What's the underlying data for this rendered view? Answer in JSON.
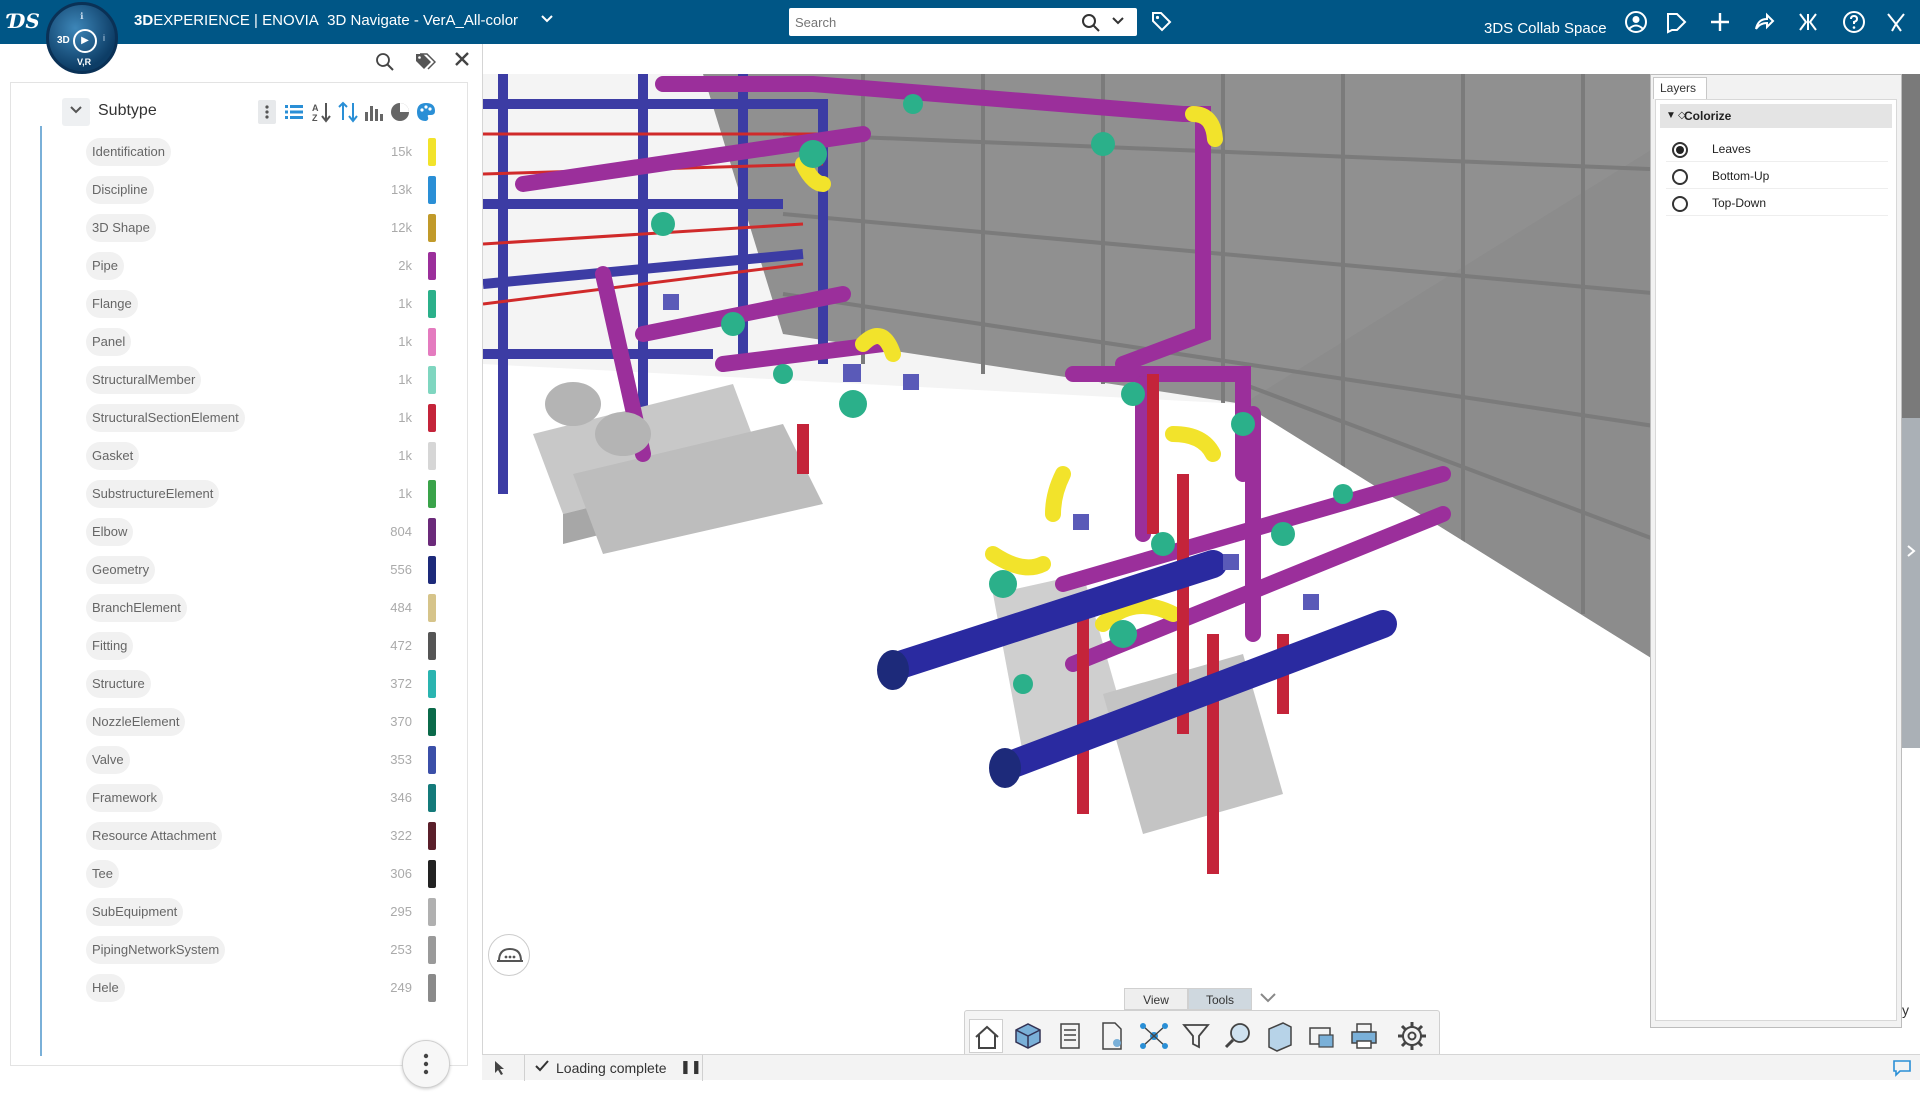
{
  "header": {
    "brand_bold": "3D",
    "brand_rest": "EXPERIENCE | ENOVIA",
    "app_name": "3D Navigate - VerA_All-color",
    "search_placeholder": "Search",
    "collab_space": "3DS Collab Space",
    "compass": {
      "label_3d": "3D",
      "label_vr": "V,R",
      "label_top": "ℹ",
      "label_right": "i"
    }
  },
  "facets": {
    "title": "Subtype",
    "items": [
      {
        "label": "Identification",
        "count": "15k",
        "color": "#f2e32b"
      },
      {
        "label": "Discipline",
        "count": "13k",
        "color": "#2a8fd6"
      },
      {
        "label": "3D Shape",
        "count": "12k",
        "color": "#c19a2a"
      },
      {
        "label": "Pipe",
        "count": "2k",
        "color": "#9b2f9b"
      },
      {
        "label": "Flange",
        "count": "1k",
        "color": "#2bb08a"
      },
      {
        "label": "Panel",
        "count": "1k",
        "color": "#e47bbf"
      },
      {
        "label": "StructuralMember",
        "count": "1k",
        "color": "#7fd6c0"
      },
      {
        "label": "StructuralSectionElement",
        "count": "1k",
        "color": "#c4243a"
      },
      {
        "label": "Gasket",
        "count": "1k",
        "color": "#d6d6d6"
      },
      {
        "label": "SubstructureElement",
        "count": "1k",
        "color": "#3aa34a"
      },
      {
        "label": "Elbow",
        "count": "804",
        "color": "#6b2a7a"
      },
      {
        "label": "Geometry",
        "count": "556",
        "color": "#1d2a7a"
      },
      {
        "label": "BranchElement",
        "count": "484",
        "color": "#d6c48a"
      },
      {
        "label": "Fitting",
        "count": "472",
        "color": "#555555"
      },
      {
        "label": "Structure",
        "count": "372",
        "color": "#2ab4b0"
      },
      {
        "label": "NozzleElement",
        "count": "370",
        "color": "#0b6a4a"
      },
      {
        "label": "Valve",
        "count": "353",
        "color": "#3b4fa8"
      },
      {
        "label": "Framework",
        "count": "346",
        "color": "#147a7a"
      },
      {
        "label": "Resource Attachment",
        "count": "322",
        "color": "#5a1f2a"
      },
      {
        "label": "Tee",
        "count": "306",
        "color": "#222222"
      },
      {
        "label": "SubEquipment",
        "count": "295",
        "color": "#b0b0b0"
      },
      {
        "label": "PipingNetworkSystem",
        "count": "253",
        "color": "#9a9a9a"
      },
      {
        "label": "Hele",
        "count": "249",
        "color": "#8a8a8a"
      }
    ]
  },
  "layers": {
    "tab": "Layers",
    "group": "Colorize",
    "options": [
      {
        "label": "Leaves",
        "selected": true
      },
      {
        "label": "Bottom-Up",
        "selected": false
      },
      {
        "label": "Top-Down",
        "selected": false
      }
    ]
  },
  "actionbar": {
    "tabs": [
      "View",
      "Tools"
    ],
    "active_tab": "Tools",
    "buttons": [
      "home-icon",
      "3d-box-icon",
      "list-icon",
      "document-icon",
      "network-icon",
      "filter-icon",
      "search-3d-icon",
      "section-icon",
      "measure-icon",
      "print-icon",
      "gear-icon"
    ]
  },
  "status": {
    "text": "Loading complete",
    "pause": "❚❚"
  },
  "misc": {
    "stray_char": "y"
  },
  "colors": {
    "header_bg": "#005686",
    "accent": "#2a8fd6"
  }
}
